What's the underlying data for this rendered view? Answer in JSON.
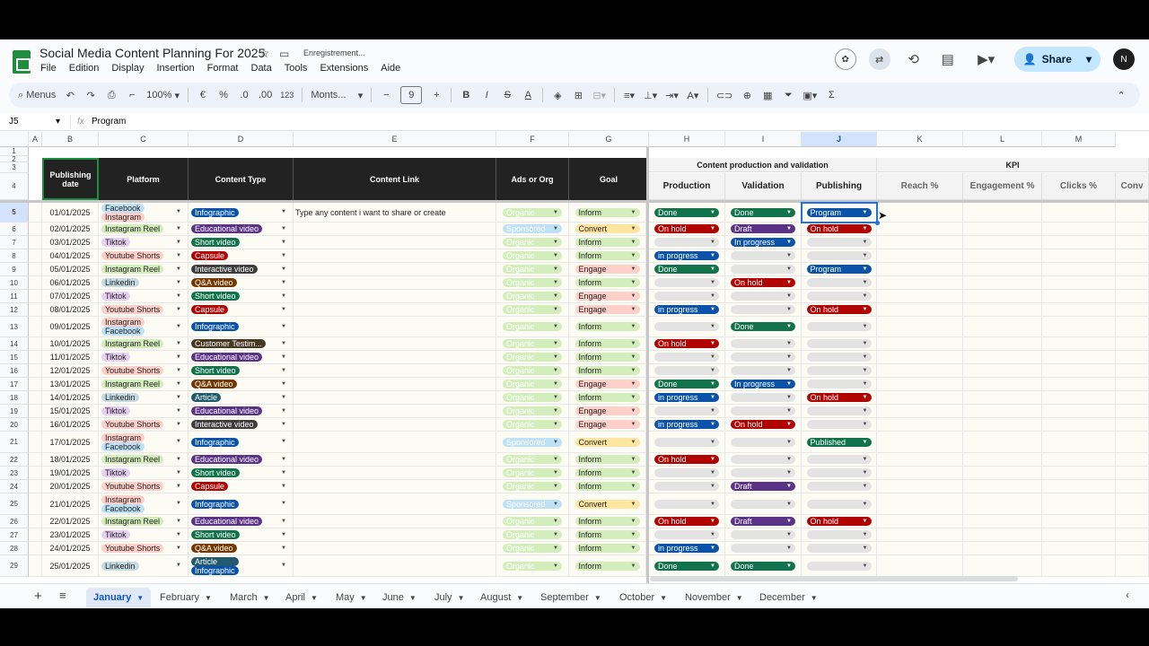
{
  "doc_title": "Social Media Content Planning For 2025",
  "saving_text": "Enregistrement...",
  "menu": [
    "File",
    "Edition",
    "Display",
    "Insertion",
    "Format",
    "Data",
    "Tools",
    "Extensions",
    "Aide"
  ],
  "share_label": "Share",
  "avatar_initial": "N",
  "toolbar": {
    "menus": "Menus",
    "zoom": "100%",
    "currency": "€",
    "percent": "%",
    "dec_less": ".0",
    "dec_more": ".00",
    "number": "123",
    "font": "Monts...",
    "font_size": "9",
    "bold": "B",
    "italic": "I",
    "strike": "S",
    "underline_a": "A"
  },
  "formula": {
    "cell_ref": "J5",
    "fx": "fx",
    "content": "Program"
  },
  "columns": [
    "A",
    "B",
    "C",
    "D",
    "E",
    "F",
    "G",
    "H",
    "I",
    "J",
    "K",
    "L",
    "M"
  ],
  "headers": {
    "publishing_date": "Publishing date",
    "platform": "Platform",
    "content_type": "Content Type",
    "content_link": "Content Link",
    "ads_or_org": "Ads or Org",
    "goal": "Goal",
    "group_cpv": "Content production and validation",
    "group_kpi": "KPI",
    "production": "Production",
    "validation": "Validation",
    "publishing": "Publishing",
    "reach": "Reach %",
    "engagement": "Engagement %",
    "clicks": "Clicks %",
    "conv": "Conv"
  },
  "row_labels": [
    "1",
    "2",
    "3",
    "4"
  ],
  "rows": [
    {
      "n": "5",
      "date": "01/01/2025",
      "platform": [
        "Facebook",
        "Instagram"
      ],
      "ctype": "Infographic",
      "link": "Type any content i want to share or create",
      "ads": "Organic",
      "goal": "Inform",
      "prod": "Done",
      "val": "Done",
      "pub": "Program",
      "h": 22
    },
    {
      "n": "6",
      "date": "02/01/2025",
      "platform": [
        "Instagram Reel"
      ],
      "ctype": "Educational video",
      "link": "",
      "ads": "Sponsored",
      "goal": "Convert",
      "prod": "On hold",
      "val": "Draft",
      "pub": "On hold",
      "h": 15
    },
    {
      "n": "7",
      "date": "03/01/2025",
      "platform": [
        "Tiktok"
      ],
      "ctype": "Short video",
      "link": "",
      "ads": "Organic",
      "goal": "Inform",
      "prod": "",
      "val": "In progress",
      "pub": "",
      "h": 15
    },
    {
      "n": "8",
      "date": "04/01/2025",
      "platform": [
        "Youtube Shorts"
      ],
      "ctype": "Capsule",
      "link": "",
      "ads": "Organic",
      "goal": "Inform",
      "prod": "in progress",
      "val": "",
      "pub": "",
      "h": 15
    },
    {
      "n": "9",
      "date": "05/01/2025",
      "platform": [
        "Instagram Reel"
      ],
      "ctype": "Interactive video",
      "link": "",
      "ads": "Organic",
      "goal": "Engage",
      "prod": "Done",
      "val": "",
      "pub": "Program",
      "h": 15
    },
    {
      "n": "10",
      "date": "06/01/2025",
      "platform": [
        "Linkedin"
      ],
      "ctype": "Q&A video",
      "link": "",
      "ads": "Organic",
      "goal": "Inform",
      "prod": "",
      "val": "On hold",
      "pub": "",
      "h": 15
    },
    {
      "n": "11",
      "date": "07/01/2025",
      "platform": [
        "Tiktok"
      ],
      "ctype": "Short video",
      "link": "",
      "ads": "Organic",
      "goal": "Engage",
      "prod": "",
      "val": "",
      "pub": "",
      "h": 15
    },
    {
      "n": "12",
      "date": "08/01/2025",
      "platform": [
        "Youtube Shorts"
      ],
      "ctype": "Capsule",
      "link": "",
      "ads": "Organic",
      "goal": "Engage",
      "prod": "in progress",
      "val": "",
      "pub": "On hold",
      "h": 15
    },
    {
      "n": "13",
      "date": "09/01/2025",
      "platform": [
        "Instagram",
        "Facebook"
      ],
      "ctype": "Infographic",
      "link": "",
      "ads": "Organic",
      "goal": "Inform",
      "prod": "",
      "val": "Done",
      "pub": "",
      "h": 23
    },
    {
      "n": "14",
      "date": "10/01/2025",
      "platform": [
        "Instagram Reel"
      ],
      "ctype": "Customer Testim...",
      "link": "",
      "ads": "Organic",
      "goal": "Inform",
      "prod": "On hold",
      "val": "",
      "pub": "",
      "h": 15
    },
    {
      "n": "15",
      "date": "11/01/2025",
      "platform": [
        "Tiktok"
      ],
      "ctype": "Educational video",
      "link": "",
      "ads": "Organic",
      "goal": "Inform",
      "prod": "",
      "val": "",
      "pub": "",
      "h": 15
    },
    {
      "n": "16",
      "date": "12/01/2025",
      "platform": [
        "Youtube Shorts"
      ],
      "ctype": "Short video",
      "link": "",
      "ads": "Organic",
      "goal": "Inform",
      "prod": "",
      "val": "",
      "pub": "",
      "h": 15
    },
    {
      "n": "17",
      "date": "13/01/2025",
      "platform": [
        "Instagram Reel"
      ],
      "ctype": "Q&A video",
      "link": "",
      "ads": "Organic",
      "goal": "Engage",
      "prod": "Done",
      "val": "In progress",
      "pub": "",
      "h": 15
    },
    {
      "n": "18",
      "date": "14/01/2025",
      "platform": [
        "Linkedin"
      ],
      "ctype": "Article",
      "link": "",
      "ads": "Organic",
      "goal": "Inform",
      "prod": "in progress",
      "val": "",
      "pub": "On hold",
      "h": 15
    },
    {
      "n": "19",
      "date": "15/01/2025",
      "platform": [
        "Tiktok"
      ],
      "ctype": "Educational video",
      "link": "",
      "ads": "Organic",
      "goal": "Engage",
      "prod": "",
      "val": "",
      "pub": "",
      "h": 15
    },
    {
      "n": "20",
      "date": "16/01/2025",
      "platform": [
        "Youtube Shorts"
      ],
      "ctype": "Interactive video",
      "link": "",
      "ads": "Organic",
      "goal": "Engage",
      "prod": "in progress",
      "val": "On hold",
      "pub": "",
      "h": 15
    },
    {
      "n": "21",
      "date": "17/01/2025",
      "platform": [
        "Instagram",
        "Facebook"
      ],
      "ctype": "Infographic",
      "link": "",
      "ads": "Sponsored",
      "goal": "Convert",
      "prod": "",
      "val": "",
      "pub": "Published",
      "h": 24
    },
    {
      "n": "22",
      "date": "18/01/2025",
      "platform": [
        "Instagram Reel"
      ],
      "ctype": "Educational video",
      "link": "",
      "ads": "Organic",
      "goal": "Inform",
      "prod": "On hold",
      "val": "",
      "pub": "",
      "h": 15
    },
    {
      "n": "23",
      "date": "19/01/2025",
      "platform": [
        "Tiktok"
      ],
      "ctype": "Short video",
      "link": "",
      "ads": "Organic",
      "goal": "Inform",
      "prod": "",
      "val": "",
      "pub": "",
      "h": 15
    },
    {
      "n": "24",
      "date": "20/01/2025",
      "platform": [
        "Youtube Shorts"
      ],
      "ctype": "Capsule",
      "link": "",
      "ads": "Organic",
      "goal": "Inform",
      "prod": "",
      "val": "Draft",
      "pub": "",
      "h": 15
    },
    {
      "n": "25",
      "date": "21/01/2025",
      "platform": [
        "Instagram",
        "Facebook"
      ],
      "ctype": "Infographic",
      "link": "",
      "ads": "Sponsored",
      "goal": "Convert",
      "prod": "",
      "val": "",
      "pub": "",
      "h": 24
    },
    {
      "n": "26",
      "date": "22/01/2025",
      "platform": [
        "Instagram Reel"
      ],
      "ctype": "Educational video",
      "link": "",
      "ads": "Organic",
      "goal": "Inform",
      "prod": "On hold",
      "val": "Draft",
      "pub": "On hold",
      "h": 15
    },
    {
      "n": "27",
      "date": "23/01/2025",
      "platform": [
        "Tiktok"
      ],
      "ctype": "Short video",
      "link": "",
      "ads": "Organic",
      "goal": "Inform",
      "prod": "",
      "val": "",
      "pub": "",
      "h": 15
    },
    {
      "n": "28",
      "date": "24/01/2025",
      "platform": [
        "Youtube Shorts"
      ],
      "ctype": "Q&A video",
      "link": "",
      "ads": "Organic",
      "goal": "Inform",
      "prod": "in progress",
      "val": "",
      "pub": "",
      "h": 15
    },
    {
      "n": "29",
      "date": "25/01/2025",
      "platform": [
        "Linkedin"
      ],
      "ctype": "Article",
      "ctype2": "Infographic",
      "link": "",
      "ads": "Organic",
      "goal": "Inform",
      "prod": "Done",
      "val": "Done",
      "pub": "",
      "h": 24
    }
  ],
  "colors": {
    "platform": {
      "Facebook": "#bfe1f6",
      "Instagram": "#ffcfc9",
      "Instagram Reel": "#d4edbc",
      "Tiktok": "#e6cff2",
      "Youtube Shorts": "#ffcfc9",
      "Linkedin": "#c6dbe1"
    },
    "ctype": {
      "Infographic": "#0a53a8",
      "Educational video": "#5a3286",
      "Short video": "#11734b",
      "Capsule": "#b10202",
      "Interactive video": "#3d3d3d",
      "Q&A video": "#753800",
      "Customer Testim...": "#473822",
      "Article": "#215a6c"
    },
    "ads": {
      "Organic": "#d4edbc",
      "Sponsored": "#bfe1f6"
    },
    "goal": {
      "Inform": "#d4edbc",
      "Convert": "#ffe5a0",
      "Engage": "#ffcfc9"
    },
    "status": {
      "Done": "#11734b",
      "On hold": "#b10202",
      "Draft": "#5a3286",
      "In progress": "#0a53a8",
      "in progress": "#0a53a8",
      "Program": "#0a53a8",
      "Published": "#11734b"
    }
  },
  "sheets": [
    "January",
    "February",
    "March",
    "April",
    "May",
    "June",
    "July",
    "August",
    "September",
    "October",
    "November",
    "December"
  ]
}
